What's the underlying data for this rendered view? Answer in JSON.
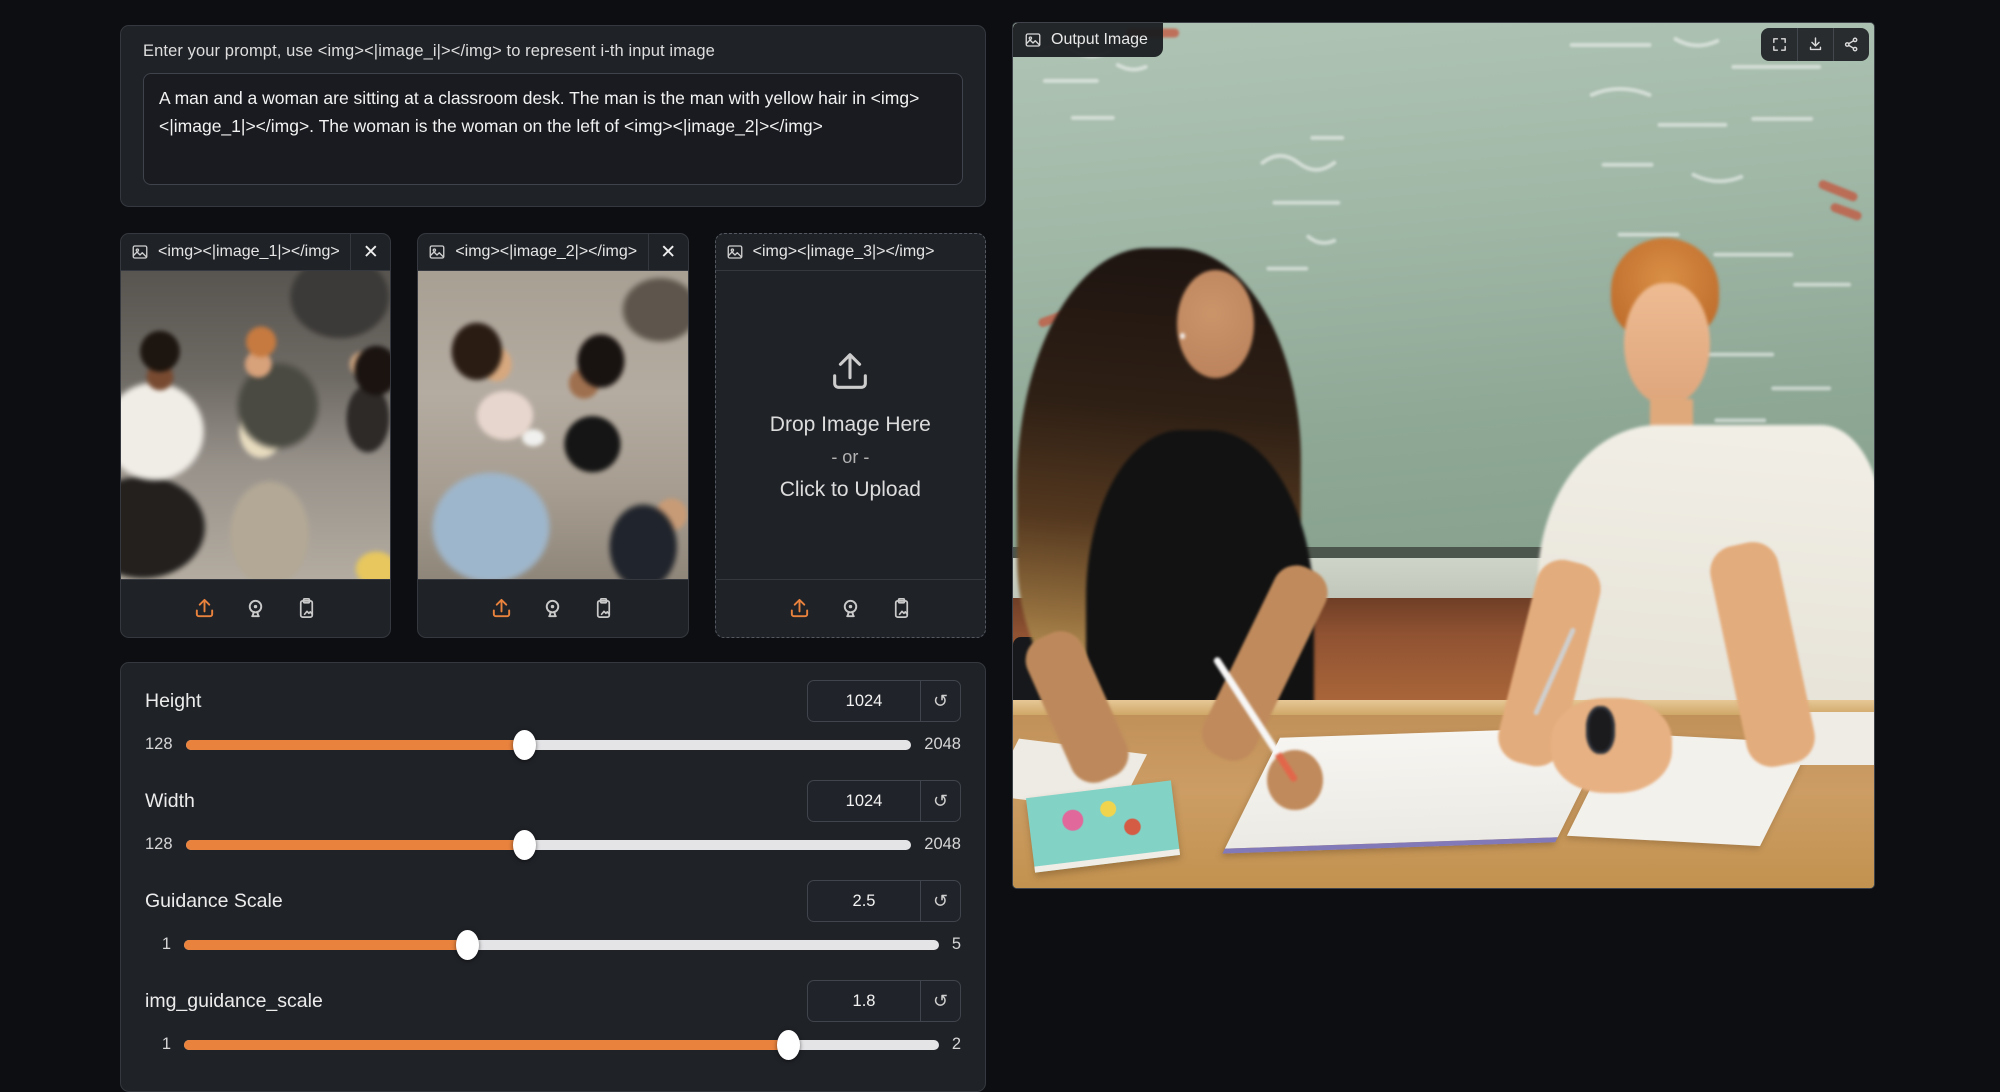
{
  "colors": {
    "accent_orange": "#e8823d",
    "page_background": "#0c0e12",
    "card_background": "#1f2227",
    "card_border": "#35393f",
    "slider_track": "#e4e4e7",
    "chalkboard_green": "#9ab3a0",
    "desk_wood": "#c2924f"
  },
  "prompt": {
    "label": "Enter your prompt, use <img><|image_i|></img> to represent i-th input image",
    "value": "A man and a woman are sitting at a classroom desk. The man is the man with yellow hair in <img><|image_1|></img>. The woman is the woman on the left of <img><|image_2|></img>"
  },
  "image_inputs": [
    {
      "title": "<img><|image_1|></img>",
      "alt": "three people on a couch playing video games"
    },
    {
      "title": "<img><|image_2|></img>",
      "alt": "two women reclining on a sofa holding game controllers"
    },
    {
      "title": "<img><|image_3|></img>",
      "drop_text": "Drop Image Here",
      "or_text": "- or -",
      "click_text": "Click to Upload"
    }
  ],
  "sliders": [
    {
      "label": "Height",
      "value": "1024",
      "min": "128",
      "max": "2048",
      "percent": 46.7
    },
    {
      "label": "Width",
      "value": "1024",
      "min": "128",
      "max": "2048",
      "percent": 46.7
    },
    {
      "label": "Guidance Scale",
      "value": "2.5",
      "min": "1",
      "max": "5",
      "percent": 37.5
    },
    {
      "label": "img_guidance_scale",
      "value": "1.8",
      "min": "1",
      "max": "2",
      "percent": 80
    }
  ],
  "output": {
    "label": "Output Image",
    "alt": "generated image: a woman in a black top and a red-haired man in a white t-shirt sitting at a classroom desk in front of a green chalkboard, writing on papers"
  },
  "glyphs": {
    "close": "✕",
    "reset": "↺"
  }
}
